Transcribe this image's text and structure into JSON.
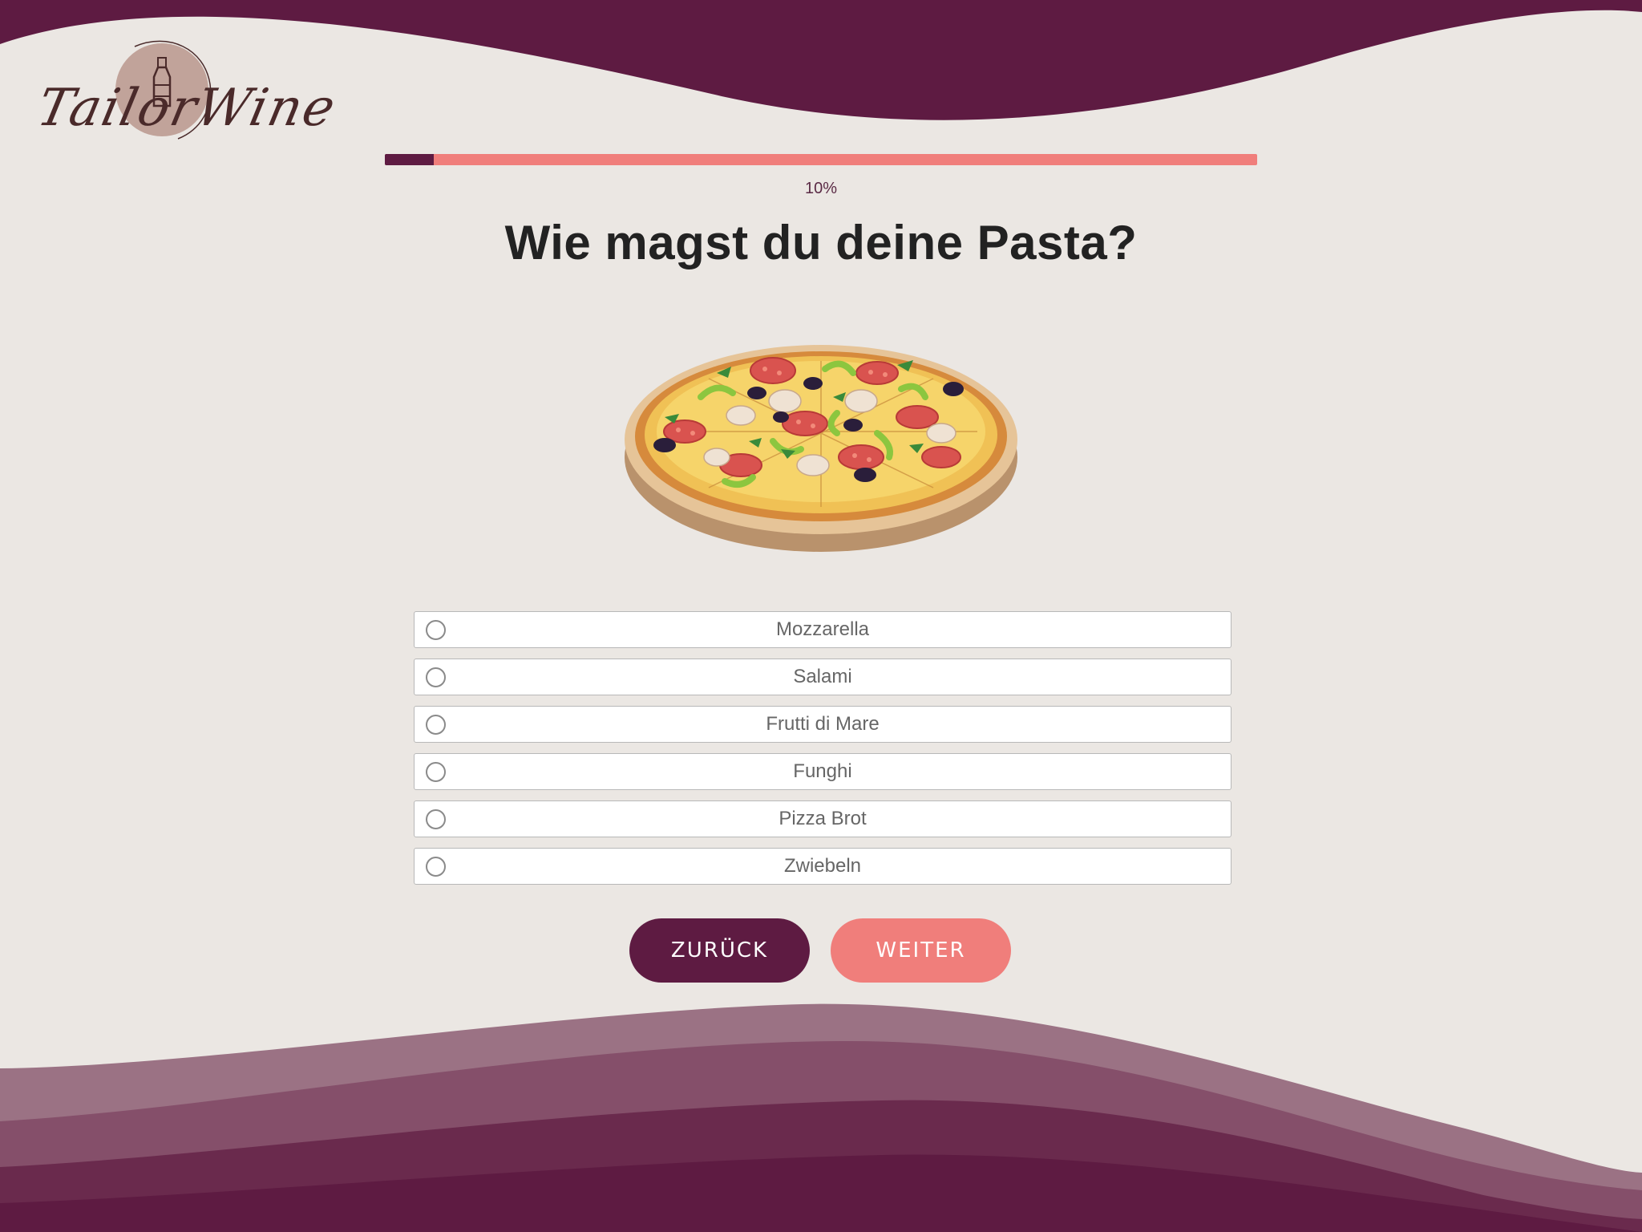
{
  "brand": {
    "logo_text": "TailorWine"
  },
  "progress": {
    "percent": 10,
    "label": "10%"
  },
  "question": {
    "title": "Wie magst du deine Pasta?",
    "image": "pizza-illustration"
  },
  "options": [
    {
      "label": "Mozzarella",
      "selected": false
    },
    {
      "label": "Salami",
      "selected": false
    },
    {
      "label": "Frutti di Mare",
      "selected": false
    },
    {
      "label": "Funghi",
      "selected": false
    },
    {
      "label": "Pizza Brot",
      "selected": false
    },
    {
      "label": "Zwiebeln",
      "selected": false
    }
  ],
  "navigation": {
    "back_label": "ZURÜCK",
    "next_label": "WEITER"
  },
  "colors": {
    "brand_dark": "#5e1b42",
    "accent_coral": "#f07e7b",
    "background": "#ebe7e3"
  }
}
